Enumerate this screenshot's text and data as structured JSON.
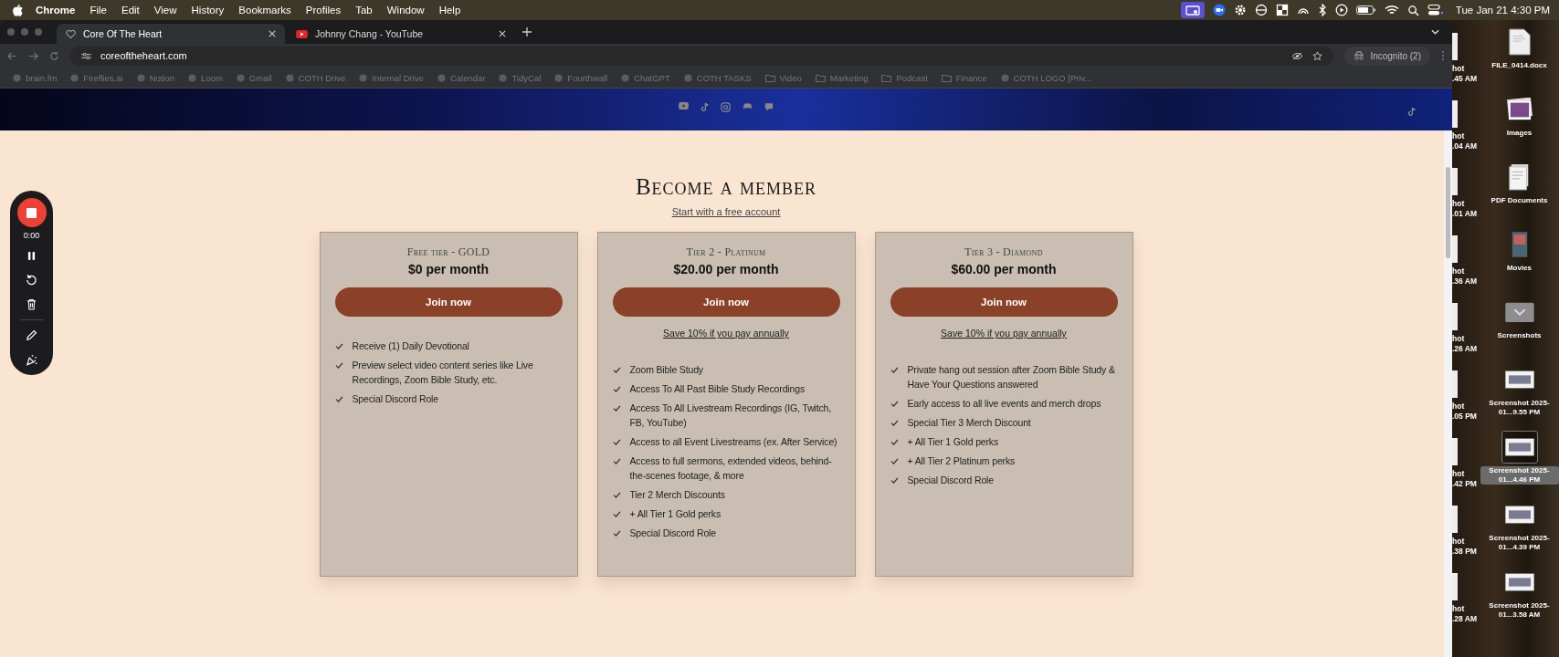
{
  "menu_bar": {
    "app": "Chrome",
    "items": [
      "File",
      "Edit",
      "View",
      "History",
      "Bookmarks",
      "Profiles",
      "Tab",
      "Window",
      "Help"
    ],
    "clock": "Tue Jan 21  4:30 PM"
  },
  "browser": {
    "tabs": [
      {
        "title": "Core Of The Heart",
        "selected": true
      },
      {
        "title": "Johnny Chang - YouTube",
        "selected": false
      }
    ],
    "address": "coreoftheheart.com",
    "profile": "Incognito (2)",
    "bookmarks": [
      {
        "label": "brain.fm",
        "kind": "site"
      },
      {
        "label": "Fireflies.ai",
        "kind": "site"
      },
      {
        "label": "Notion",
        "kind": "site"
      },
      {
        "label": "Loom",
        "kind": "site"
      },
      {
        "label": "Gmail",
        "kind": "site"
      },
      {
        "label": "COTH Drive",
        "kind": "site"
      },
      {
        "label": "Internal Drive",
        "kind": "site"
      },
      {
        "label": "Calendar",
        "kind": "site"
      },
      {
        "label": "TidyCal",
        "kind": "site"
      },
      {
        "label": "Fourthwall",
        "kind": "site"
      },
      {
        "label": "ChatGPT",
        "kind": "site"
      },
      {
        "label": "COTH TASKS",
        "kind": "site"
      },
      {
        "label": "Video",
        "kind": "folder"
      },
      {
        "label": "Marketing",
        "kind": "folder"
      },
      {
        "label": "Podcast",
        "kind": "folder"
      },
      {
        "label": "Finance",
        "kind": "folder"
      },
      {
        "label": "COTH LOGO [Priv...",
        "kind": "site"
      }
    ]
  },
  "recorder": {
    "time": "0:00"
  },
  "page": {
    "heading": "Become a member",
    "subheading_link": "Start with a free account",
    "tiers": [
      {
        "name": "Free tier - GOLD",
        "price": "$0 per month",
        "button": "Join now",
        "features": [
          "Receive (1) Daily Devotional",
          "Preview select video content series like Live Recordings, Zoom Bible Study, etc.",
          "Special Discord Role"
        ]
      },
      {
        "name": "Tier 2 - Platinum",
        "price": "$20.00 per month",
        "button": "Join now",
        "annual_link": "Save 10% if you pay annually",
        "features": [
          "Zoom Bible Study",
          "Access To All Past Bible Study Recordings",
          "Access To All Livestream Recordings (IG, Twitch, FB, YouTube)",
          "Access to all Event Livestreams (ex. After Service)",
          "Access to full sermons, extended videos, behind-the-scenes footage, & more",
          "Tier 2 Merch Discounts",
          "+ All Tier 1 Gold perks",
          "Special Discord Role"
        ]
      },
      {
        "name": "Tier 3 - Diamond",
        "price": "$60.00 per month",
        "button": "Join now",
        "annual_link": "Save 10% if you pay annually",
        "features": [
          "Private hang out session after Zoom Bible Study & Have Your Questions answered",
          "Early access to all live events and merch drops",
          "Special Tier 3 Merch Discount",
          "+ All Tier 1 Gold perks",
          "+ All Tier 2 Platinum perks",
          "Special Discord Role"
        ]
      }
    ]
  },
  "desktop": {
    "partial_items": [
      {
        "line1": "hot",
        "line2": ".45 AM"
      },
      {
        "line1": "hot",
        "line2": ".04 AM"
      },
      {
        "line1": "hot",
        "line2": ".01 AM"
      },
      {
        "line1": "hot",
        "line2": ".36 AM"
      },
      {
        "line1": "hot",
        "line2": ".26 AM"
      },
      {
        "line1": "hot",
        "line2": ".05 PM"
      },
      {
        "line1": "hot",
        "line2": ".42 PM"
      },
      {
        "line1": "hot",
        "line2": ".38 PM"
      },
      {
        "line1": "hot",
        "line2": ".28 AM"
      }
    ],
    "items": [
      {
        "label": "FILE_0414.docx",
        "kind": "document",
        "selected": false
      },
      {
        "label": "Images",
        "kind": "photos",
        "selected": false
      },
      {
        "label": "PDF Documents",
        "kind": "pdfs",
        "selected": false
      },
      {
        "label": "Movies",
        "kind": "movies",
        "selected": false
      },
      {
        "label": "Screenshots",
        "kind": "folder",
        "selected": false
      },
      {
        "label": "Screenshot 2025-01...9.55 PM",
        "kind": "screenshot",
        "selected": false
      },
      {
        "label": "Screenshot 2025-01...4.46 PM",
        "kind": "screenshot",
        "selected": true
      },
      {
        "label": "Screenshot 2025-01...4.39 PM",
        "kind": "screenshot",
        "selected": false
      },
      {
        "label": "Screenshot 2025-01...3.58 AM",
        "kind": "screenshot",
        "selected": false
      }
    ]
  }
}
